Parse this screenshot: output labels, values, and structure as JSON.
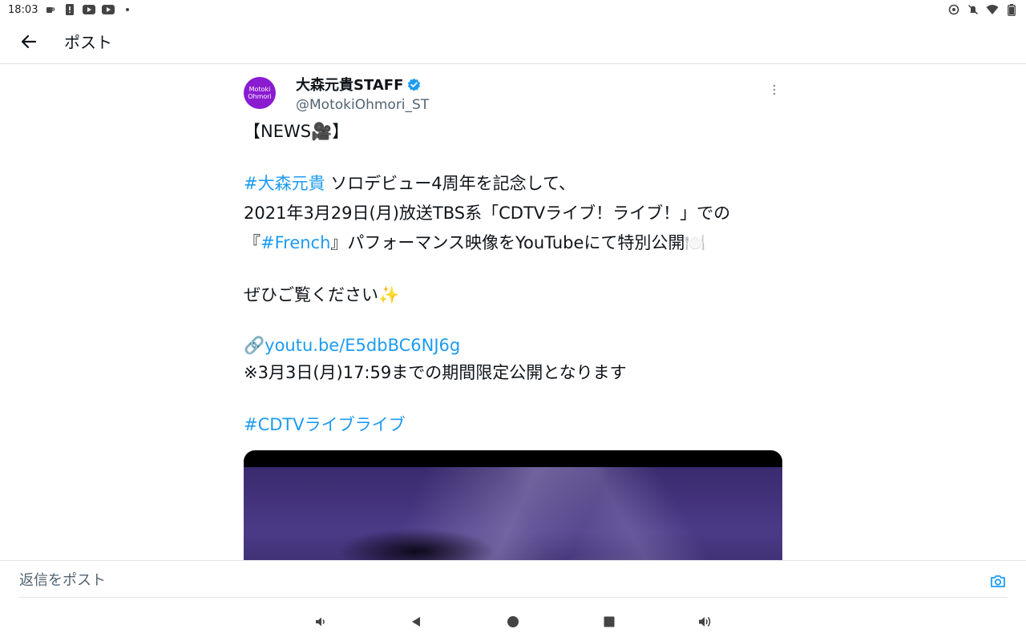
{
  "status_bar": {
    "time": "18:03",
    "left_icons": [
      "coffee-icon",
      "alert-icon",
      "youtube-icon",
      "youtube-icon",
      "dot-icon"
    ],
    "right_icons": [
      "data-saver-icon",
      "mute-icon",
      "wifi-icon",
      "battery-icon"
    ]
  },
  "app_bar": {
    "title": "ポスト"
  },
  "tweet": {
    "avatar_text": [
      "Motoki",
      "Ohmori"
    ],
    "author_name": "大森元貴STAFF",
    "handle": "@MotokiOhmori_ST",
    "verified_color": "#1d9bf0",
    "lines": {
      "l1": "【NEWS🎥】",
      "l2_tag": "#大森元貴",
      "l2_rest": " ソロデビュー4周年を記念して、",
      "l3": "2021年3月29日(月)放送TBS系「CDTVライブ！ライブ！」での",
      "l4_open": "『",
      "l4_tag": "#French",
      "l4_rest": "』パフォーマンス映像をYouTubeにて特別公開🍽️",
      "l5": "ぜひご覧ください✨",
      "l6_icon": "🔗",
      "l6_link": "youtu.be/E5dbBC6NJ6g",
      "l7": "※3月3日(月)17:59までの期間限定公開となります",
      "l8_tag": "#CDTVライブライブ"
    }
  },
  "reply": {
    "placeholder": "返信をポスト"
  },
  "colors": {
    "link": "#1d9bf0",
    "avatar_bg": "#8a1bd1",
    "divider": "#e1e5e8"
  }
}
